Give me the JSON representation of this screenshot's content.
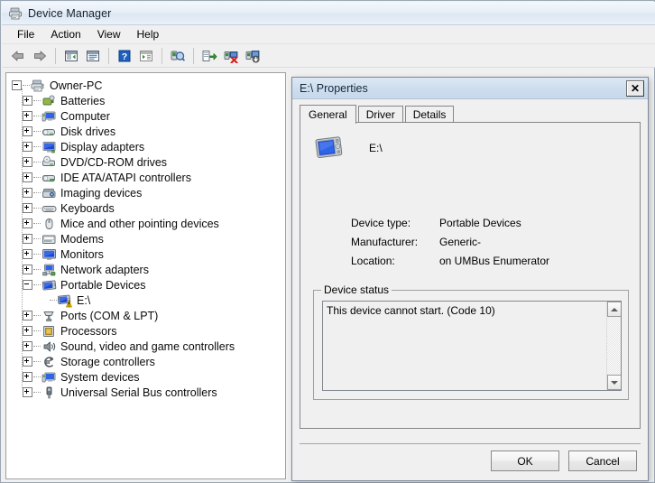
{
  "window": {
    "title": "Device Manager",
    "icon": "device-manager-icon",
    "menu": [
      "File",
      "Action",
      "View",
      "Help"
    ],
    "toolbar": [
      {
        "name": "back-icon",
        "type": "button"
      },
      {
        "name": "forward-icon",
        "type": "button"
      },
      {
        "name": "separator",
        "type": "separator"
      },
      {
        "name": "show-tree-icon",
        "type": "button"
      },
      {
        "name": "properties-icon",
        "type": "button"
      },
      {
        "name": "separator",
        "type": "separator"
      },
      {
        "name": "help-icon",
        "type": "button"
      },
      {
        "name": "show-details-icon",
        "type": "button"
      },
      {
        "name": "separator",
        "type": "separator"
      },
      {
        "name": "scan-hardware-changes-icon",
        "type": "button"
      },
      {
        "name": "separator",
        "type": "separator"
      },
      {
        "name": "update-driver-icon",
        "type": "button"
      },
      {
        "name": "uninstall-device-icon",
        "type": "button"
      },
      {
        "name": "disable-device-icon",
        "type": "button"
      }
    ]
  },
  "tree": {
    "root": {
      "label": "Owner-PC",
      "icon": "computer-icon",
      "expanded": true
    },
    "items": [
      {
        "label": "Batteries",
        "icon": "battery-icon",
        "expander": "plus",
        "depth": 1
      },
      {
        "label": "Computer",
        "icon": "computer-small-icon",
        "expander": "plus",
        "depth": 1
      },
      {
        "label": "Disk drives",
        "icon": "disk-drive-icon",
        "expander": "plus",
        "depth": 1
      },
      {
        "label": "Display adapters",
        "icon": "display-adapter-icon",
        "expander": "plus",
        "depth": 1
      },
      {
        "label": "DVD/CD-ROM drives",
        "icon": "dvd-drive-icon",
        "expander": "plus",
        "depth": 1
      },
      {
        "label": "IDE ATA/ATAPI controllers",
        "icon": "ide-controller-icon",
        "expander": "plus",
        "depth": 1
      },
      {
        "label": "Imaging devices",
        "icon": "imaging-device-icon",
        "expander": "plus",
        "depth": 1
      },
      {
        "label": "Keyboards",
        "icon": "keyboard-icon",
        "expander": "plus",
        "depth": 1
      },
      {
        "label": "Mice and other pointing devices",
        "icon": "mouse-icon",
        "expander": "plus",
        "depth": 1
      },
      {
        "label": "Modems",
        "icon": "modem-icon",
        "expander": "plus",
        "depth": 1
      },
      {
        "label": "Monitors",
        "icon": "monitor-icon",
        "expander": "plus",
        "depth": 1
      },
      {
        "label": "Network adapters",
        "icon": "network-adapter-icon",
        "expander": "plus",
        "depth": 1
      },
      {
        "label": "Portable Devices",
        "icon": "portable-device-icon",
        "expander": "minus",
        "depth": 1
      },
      {
        "label": "E:\\",
        "icon": "portable-device-warning-icon",
        "expander": "none",
        "depth": 2
      },
      {
        "label": "Ports (COM & LPT)",
        "icon": "port-icon",
        "expander": "plus",
        "depth": 1
      },
      {
        "label": "Processors",
        "icon": "processor-icon",
        "expander": "plus",
        "depth": 1
      },
      {
        "label": "Sound, video and game controllers",
        "icon": "sound-controller-icon",
        "expander": "plus",
        "depth": 1
      },
      {
        "label": "Storage controllers",
        "icon": "storage-controller-icon",
        "expander": "plus",
        "depth": 1
      },
      {
        "label": "System devices",
        "icon": "system-device-icon",
        "expander": "plus",
        "depth": 1
      },
      {
        "label": "Universal Serial Bus controllers",
        "icon": "usb-controller-icon",
        "expander": "plus",
        "depth": 1
      }
    ]
  },
  "dialog": {
    "title": "E:\\ Properties",
    "close_label": "✕",
    "tabs": [
      {
        "label": "General",
        "active": true
      },
      {
        "label": "Driver",
        "active": false
      },
      {
        "label": "Details",
        "active": false
      }
    ],
    "device": {
      "icon": "portable-device-icon",
      "name": "E:\\"
    },
    "info": [
      {
        "key": "Device type:",
        "value": "Portable Devices"
      },
      {
        "key": "Manufacturer:",
        "value": "Generic-"
      },
      {
        "key": "Location:",
        "value": "on UMBus Enumerator"
      }
    ],
    "status": {
      "legend": "Device status",
      "text": "This device cannot start. (Code 10)"
    },
    "buttons": [
      {
        "label": "OK",
        "name": "ok-button"
      },
      {
        "label": "Cancel",
        "name": "cancel-button"
      }
    ]
  },
  "colors": {
    "warning": "#ffcc00",
    "device_blue": "#1a49d8",
    "titlebar": "#dce6f2",
    "dialog_face": "#f0f0f0"
  }
}
